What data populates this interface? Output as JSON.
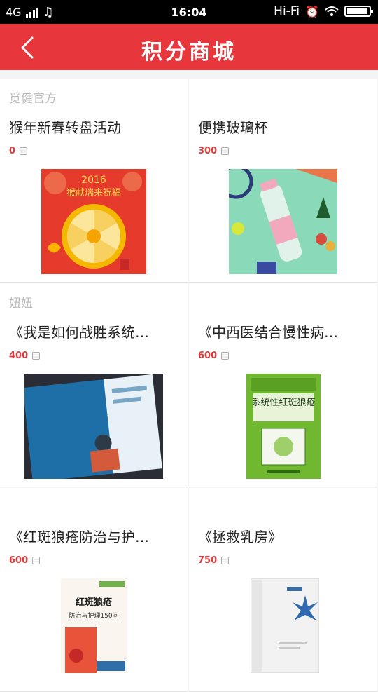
{
  "status_bar": {
    "network": "4G",
    "time": "16:04",
    "wifi_label": "Hi-Fi"
  },
  "header": {
    "title": "积分商城"
  },
  "products": [
    {
      "seller": "觅健官方",
      "name": "猴年新春转盘活动",
      "price": "0",
      "image": "spring-festival-wheel-image",
      "image_text": {
        "year": "2016",
        "banner": "猴献瑞来祝福"
      }
    },
    {
      "seller": "",
      "name": "便携玻璃杯",
      "price": "300",
      "image": "glass-cup-image"
    },
    {
      "seller": "妞妞",
      "name": "《我是如何战胜系统…",
      "price": "400",
      "image": "book-cover-image-1"
    },
    {
      "seller": "",
      "name": "《中西医结合慢性病…",
      "price": "600",
      "image": "book-cover-image-2",
      "image_text": {
        "book_title": "系统性红斑狼疮"
      }
    },
    {
      "seller": "",
      "name": "《红斑狼疮防治与护…",
      "price": "600",
      "image": "book-cover-image-3",
      "image_text": {
        "book_title": "红斑狼疮",
        "book_subtitle": "防治与护理150问"
      }
    },
    {
      "seller": "",
      "name": "《拯救乳房》",
      "price": "750",
      "image": "book-cover-image-4"
    }
  ],
  "colors": {
    "brand_red": "#e8363d",
    "price_red": "#e03a3a"
  }
}
